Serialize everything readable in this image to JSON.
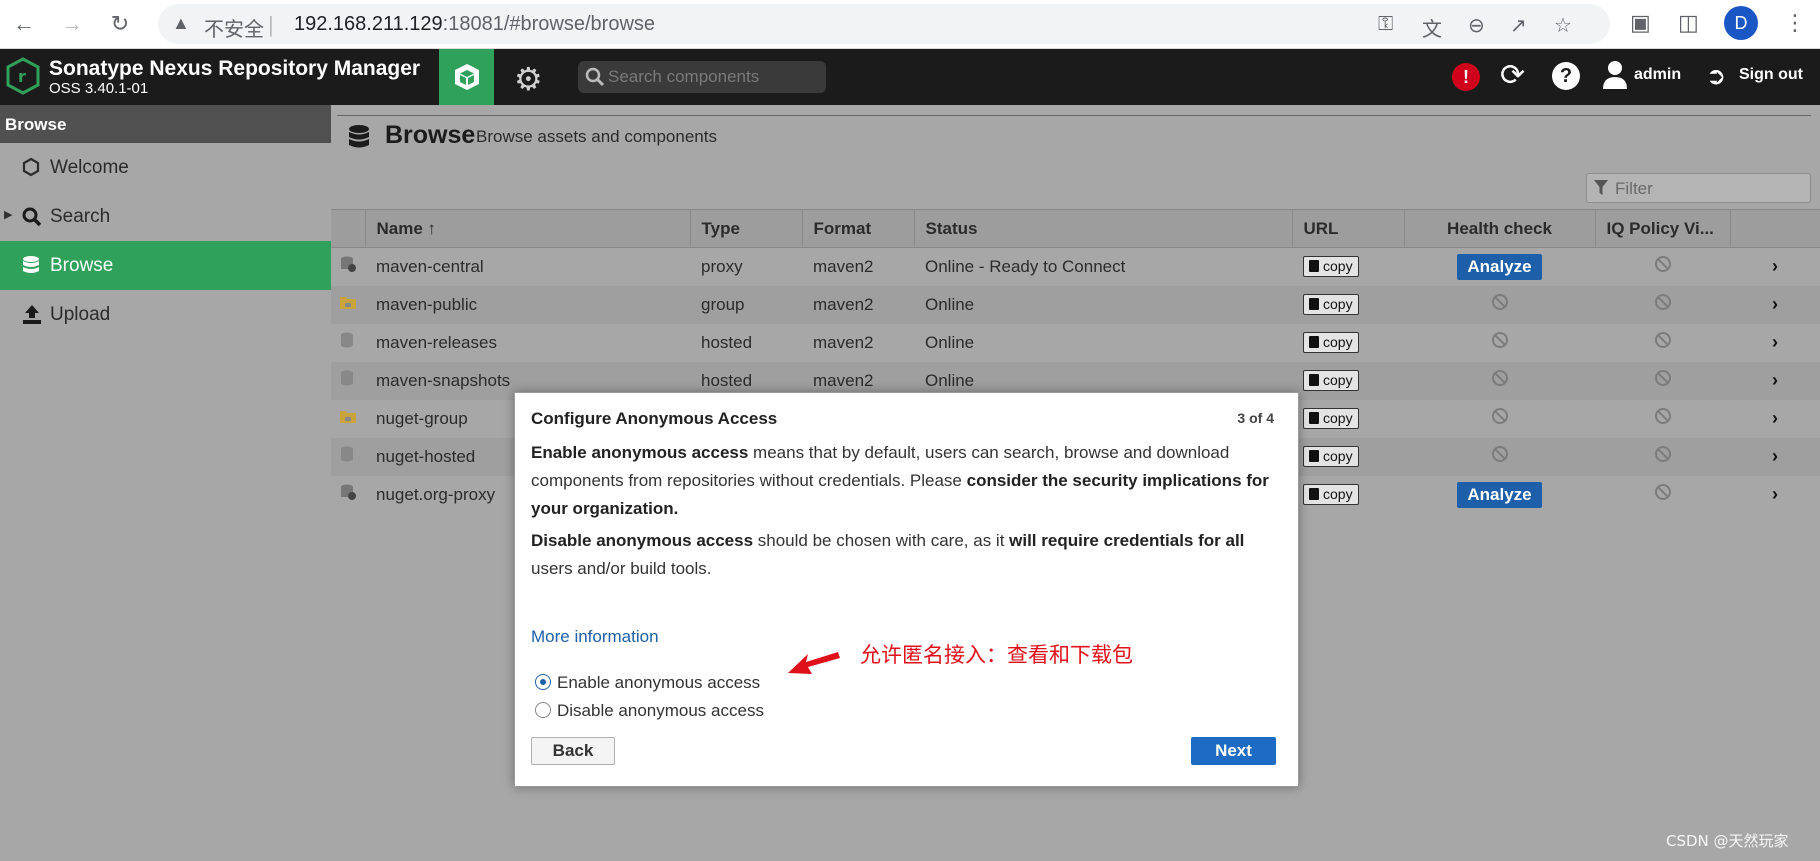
{
  "browser": {
    "security_label": "不安全",
    "url_host": "192.168.211.129",
    "url_rest": ":18081/#browse/browse",
    "profile_initial": "D"
  },
  "header": {
    "title": "Sonatype Nexus Repository Manager",
    "version": "OSS 3.40.1-01",
    "search_placeholder": "Search components",
    "user": "admin",
    "signout": "Sign out"
  },
  "sidebar": {
    "title": "Browse",
    "items": [
      {
        "label": "Welcome"
      },
      {
        "label": "Search"
      },
      {
        "label": "Browse"
      },
      {
        "label": "Upload"
      }
    ]
  },
  "main": {
    "title": "Browse",
    "subtitle": "Browse assets and components",
    "filter_placeholder": "Filter",
    "columns": [
      "Name ↑",
      "Type",
      "Format",
      "Status",
      "URL",
      "Health check",
      "IQ Policy Vi..."
    ],
    "copy_label": "copy",
    "analyze_label": "Analyze",
    "rows": [
      {
        "name": "maven-central",
        "type": "proxy",
        "format": "maven2",
        "status": "Online - Ready to Connect"
      },
      {
        "name": "maven-public",
        "type": "group",
        "format": "maven2",
        "status": "Online"
      },
      {
        "name": "maven-releases",
        "type": "hosted",
        "format": "maven2",
        "status": "Online"
      },
      {
        "name": "maven-snapshots",
        "type": "hosted",
        "format": "maven2",
        "status": "Online"
      },
      {
        "name": "nuget-group",
        "type": "",
        "format": "",
        "status": ""
      },
      {
        "name": "nuget-hosted",
        "type": "",
        "format": "",
        "status": ""
      },
      {
        "name": "nuget.org-proxy",
        "type": "",
        "format": "",
        "status": ""
      }
    ]
  },
  "modal": {
    "title": "Configure Anonymous Access",
    "step": "3 of 4",
    "p1_b1": "Enable anonymous access",
    "p1_t1": " means that by default, users can search, browse and download components from repositories without credentials. Please ",
    "p1_b2": "consider the security implications for your organization.",
    "p2_b1": "Disable anonymous access",
    "p2_t1": " should be chosen with care, as it ",
    "p2_b2": "will require credentials for all",
    "p2_t2": " users and/or build tools.",
    "more_info": "More information",
    "option_enable": "Enable anonymous access",
    "option_disable": "Disable anonymous access",
    "back": "Back",
    "next": "Next"
  },
  "annotation": "允许匿名接入：查看和下载包",
  "watermark": "CSDN @天然玩家",
  "colors": {
    "accent_green": "#2fa15a",
    "analyze_blue": "#1d5fa8",
    "annotation_red": "#e0101a"
  }
}
